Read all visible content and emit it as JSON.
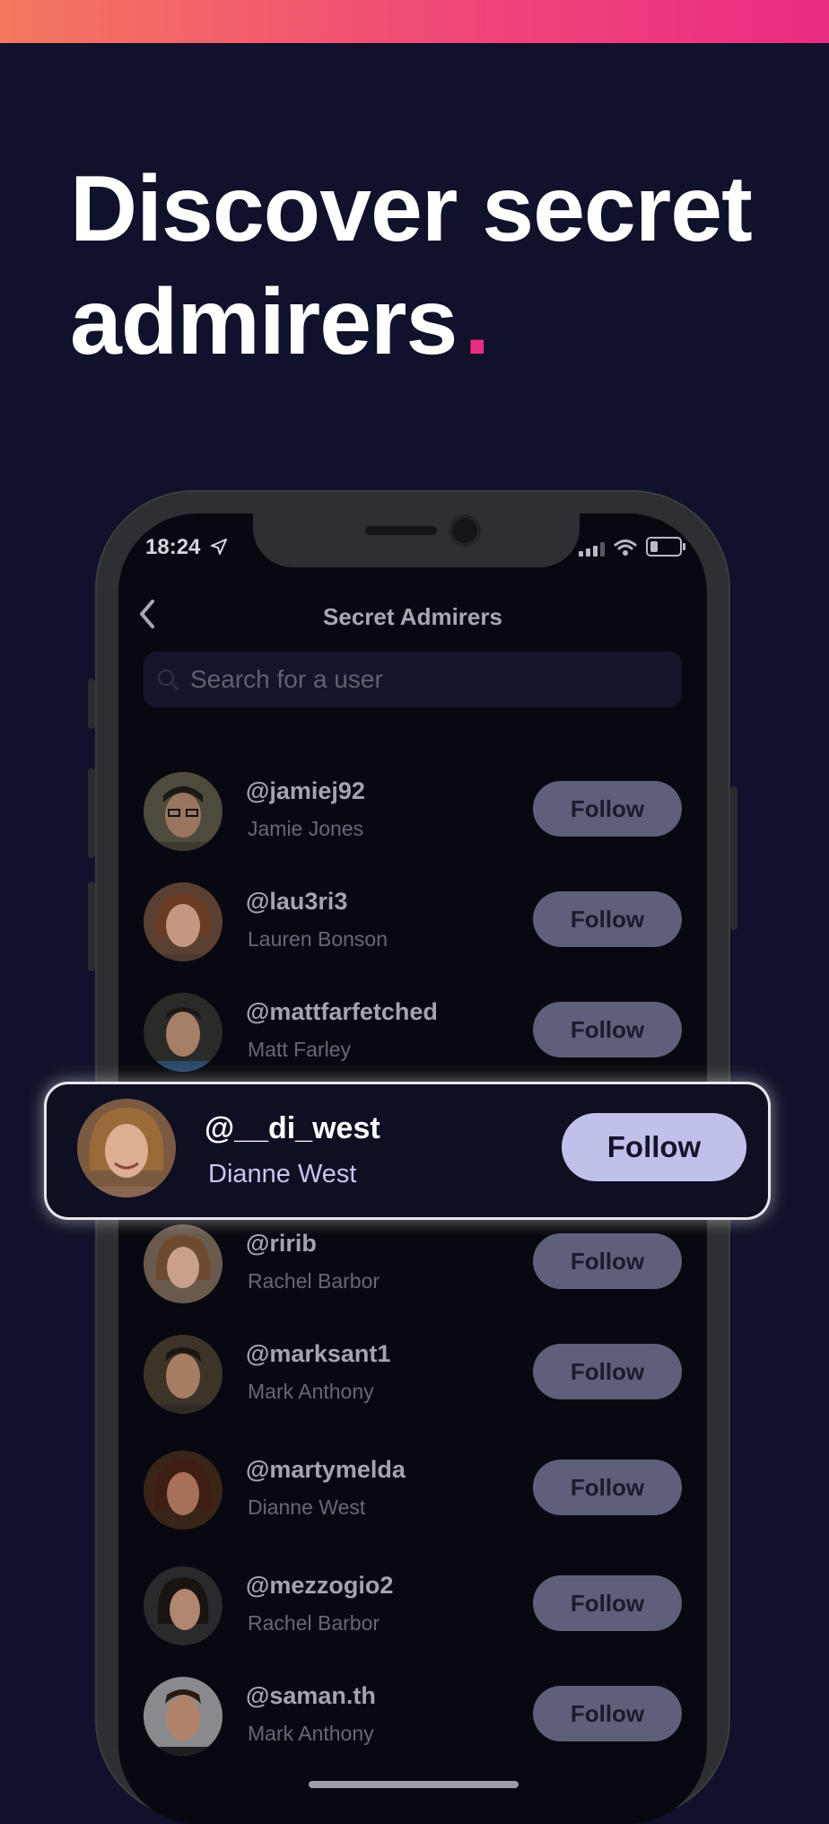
{
  "banner": {
    "headline_line1": "Discover secret",
    "headline_line2": "admirers",
    "headline_dot": ".",
    "accent_color": "#ea2c82"
  },
  "status_bar": {
    "time": "18:24",
    "icons": [
      "location-arrow-icon",
      "signal-icon",
      "wifi-icon",
      "battery-icon"
    ]
  },
  "screen": {
    "title": "Secret Admirers",
    "back_icon": "chevron-left-icon",
    "search": {
      "placeholder": "Search for a user",
      "value": ""
    }
  },
  "users": [
    {
      "username": "@jamiej92",
      "name": "Jamie Jones",
      "button": "Follow"
    },
    {
      "username": "@lau3ri3",
      "name": "Lauren Bonson",
      "button": "Follow"
    },
    {
      "username": "@mattfarfetched",
      "name": "Matt Farley",
      "button": "Follow"
    },
    {
      "username": "@ririb",
      "name": "Rachel Barbor",
      "button": "Follow"
    },
    {
      "username": "@marksant1",
      "name": "Mark Anthony",
      "button": "Follow"
    },
    {
      "username": "@martymelda",
      "name": "Dianne West",
      "button": "Follow"
    },
    {
      "username": "@mezzogio2",
      "name": "Rachel Barbor",
      "button": "Follow"
    },
    {
      "username": "@saman.th",
      "name": "Mark Anthony",
      "button": "Follow"
    }
  ],
  "highlighted_user": {
    "username": "@__di_west",
    "name": "Dianne West",
    "button": "Follow"
  }
}
